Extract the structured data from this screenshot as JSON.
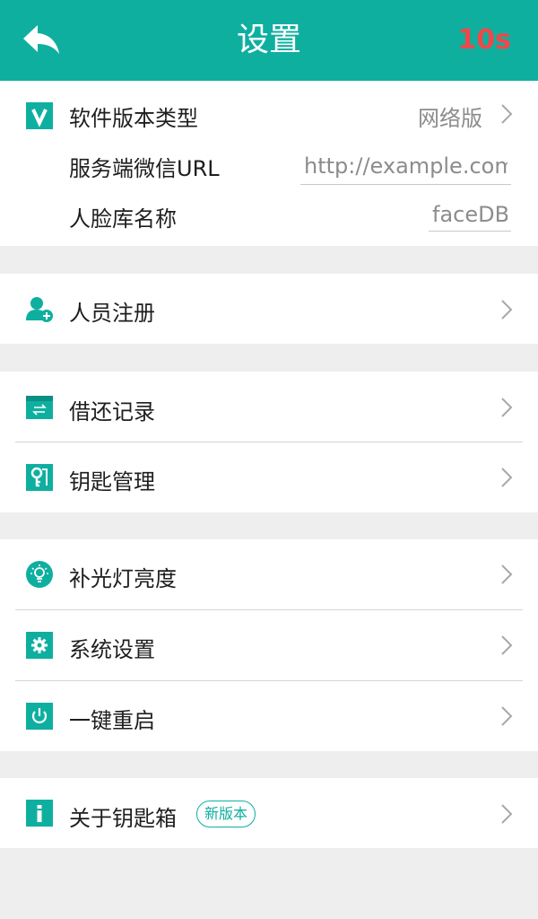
{
  "header": {
    "title": "设置",
    "countdown": "10s",
    "back_icon": "back-arrow-icon"
  },
  "config": {
    "version_type_label": "软件版本类型",
    "version_type_value": "网络版",
    "server_url_label": "服务端微信URL",
    "server_url_value": "http://example.com",
    "face_db_label": "人脸库名称",
    "face_db_value": "faceDB"
  },
  "menu": {
    "person_register": "人员注册",
    "borrow_return_records": "借还记录",
    "key_management": "钥匙管理",
    "fill_light_brightness": "补光灯亮度",
    "system_settings": "系统设置",
    "one_key_restart": "一键重启",
    "about_keybox": "关于钥匙箱",
    "new_version_badge": "新版本"
  },
  "colors": {
    "accent": "#0fafa0",
    "countdown": "#f04848",
    "background": "#eeeeee"
  }
}
